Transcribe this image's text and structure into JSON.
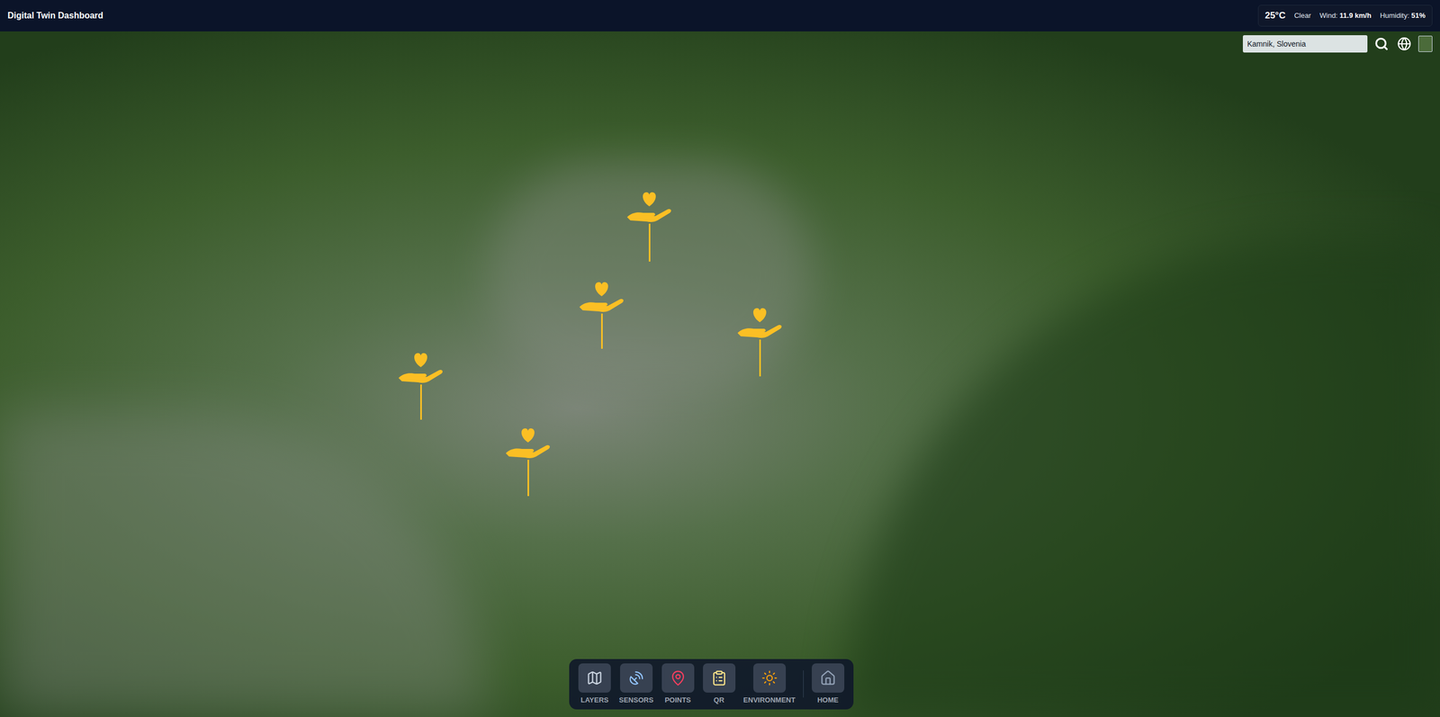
{
  "window": {
    "title": "Digital Twin Dashboard"
  },
  "weather": {
    "temperature": "25°C",
    "condition": "Clear",
    "wind_label": "Wind:",
    "wind": "11.9 km/h",
    "humidity_label": "Humidity:",
    "humidity": "51%"
  },
  "search": {
    "value": "Kamnik, Slovenia"
  },
  "toolbar": [
    {
      "label": "LAYERS",
      "kind": "layers"
    },
    {
      "label": "SENSORS",
      "kind": "sensors"
    },
    {
      "label": "POINTS",
      "kind": "points"
    },
    {
      "label": "QR",
      "kind": "qr"
    },
    {
      "label": "ENVIRONMENT",
      "kind": "environment"
    },
    {
      "label": "HOME",
      "kind": "home"
    }
  ]
}
